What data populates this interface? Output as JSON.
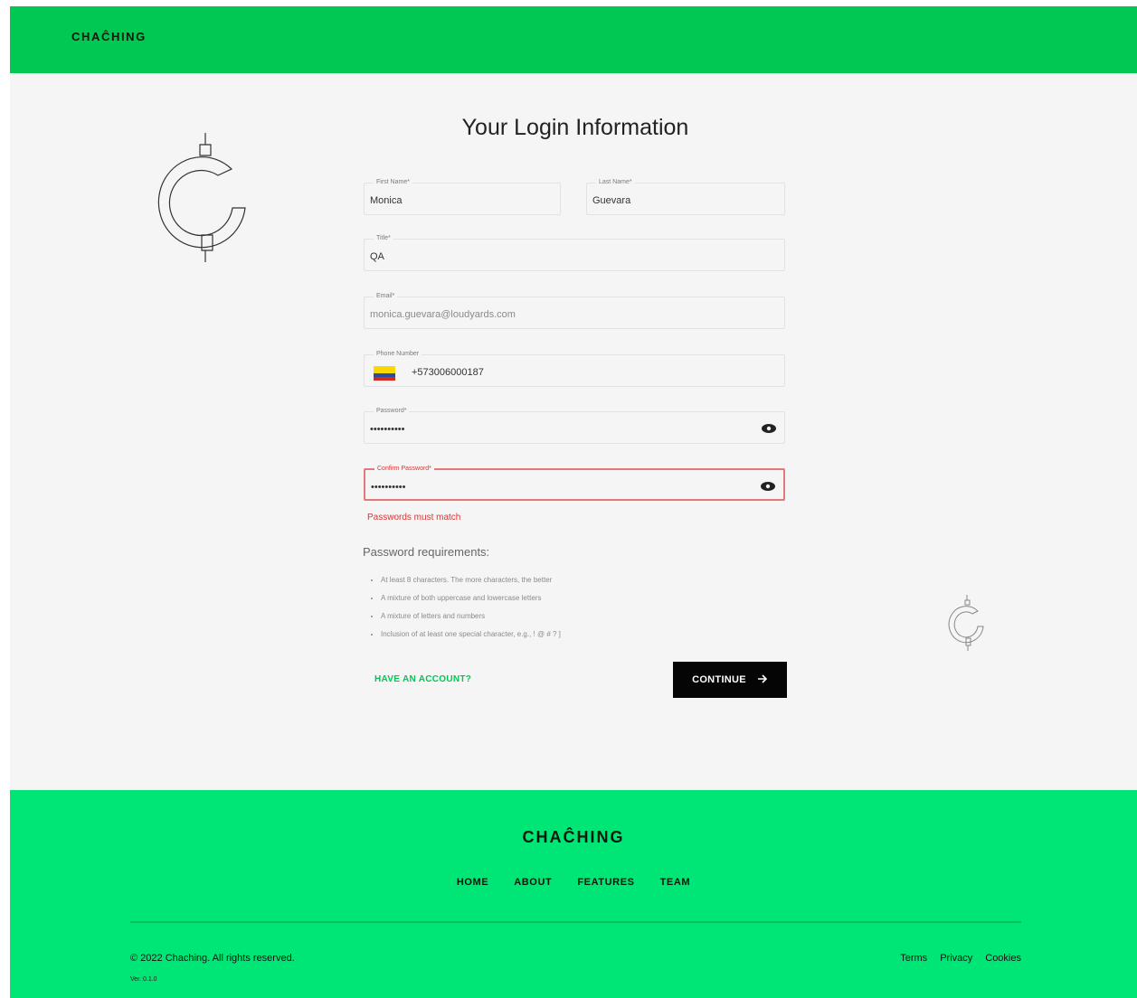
{
  "header": {
    "brand": "CHAĈHING"
  },
  "page": {
    "title": "Your Login Information"
  },
  "form": {
    "first_name": {
      "label": "First Name*",
      "value": "Monica"
    },
    "last_name": {
      "label": "Last Name*",
      "value": "Guevara"
    },
    "title": {
      "label": "Title*",
      "value": "QA"
    },
    "email": {
      "label": "Email*",
      "value": "monica.guevara@loudyards.com"
    },
    "phone": {
      "label": "Phone Number",
      "value": "+573006000187",
      "flag_icon": "colombia-flag-icon"
    },
    "password": {
      "label": "Password*",
      "value": "••••••••••"
    },
    "confirm_password": {
      "label": "Confirm Password*",
      "value": "••••••••••",
      "error": "Passwords must match"
    }
  },
  "requirements": {
    "title": "Password requirements:",
    "items": [
      "At least 8 characters. The more characters, the better",
      "A mixture of both uppercase and lowercase letters",
      "A mixture of letters and numbers",
      "Inclusion of at least one special character, e.g., ! @ # ? ]"
    ]
  },
  "actions": {
    "have_account": "HAVE AN ACCOUNT?",
    "continue": "CONTINUE"
  },
  "footer": {
    "brand": "CHAĈHING",
    "nav": [
      "HOME",
      "ABOUT",
      "FEATURES",
      "TEAM"
    ],
    "copyright": "© 2022 Chaching. All rights reserved.",
    "version": "Ver. 0.1.0",
    "legal": [
      "Terms",
      "Privacy",
      "Cookies"
    ]
  },
  "colors": {
    "brand_green": "#00c853",
    "footer_green": "#00e676",
    "error_red": "#d33333",
    "button_black": "#050505"
  }
}
